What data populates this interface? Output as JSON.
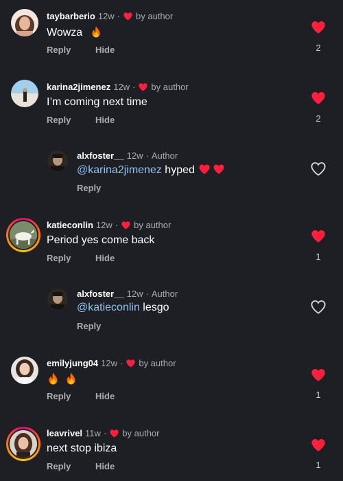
{
  "colors": {
    "background": "#1d1f24",
    "like_red": "#ff1f3d",
    "mention": "#8ec3f2",
    "muted": "#a9acb3"
  },
  "comments": [
    {
      "user": "taybarberio",
      "time": "12w",
      "badge": "by author",
      "text": "Wowza",
      "emoji": "fire",
      "reply": "Reply",
      "hide": "Hide",
      "likes": "2",
      "liked": true
    },
    {
      "user": "karina2jimenez",
      "time": "12w",
      "badge": "by author",
      "text": "I’m coming next time",
      "reply": "Reply",
      "hide": "Hide",
      "likes": "2",
      "liked": true
    },
    {
      "user": "alxfoster__",
      "time": "12w",
      "badge": "Author",
      "mention": "@karina2jimenez",
      "text": " hyped",
      "emoji": "hearts",
      "reply": "Reply",
      "liked": false
    },
    {
      "user": "katieconlin",
      "time": "12w",
      "badge": "by author",
      "text": "Period yes come back",
      "reply": "Reply",
      "hide": "Hide",
      "likes": "1",
      "liked": true
    },
    {
      "user": "alxfoster__",
      "time": "12w",
      "badge": "Author",
      "mention": "@katieconlin",
      "text": " lesgo",
      "reply": "Reply",
      "liked": false
    },
    {
      "user": "emilyjung04",
      "time": "12w",
      "badge": "by author",
      "emoji": "fire-fire",
      "reply": "Reply",
      "hide": "Hide",
      "likes": "1",
      "liked": true
    },
    {
      "user": "leavrivel",
      "time": "11w",
      "badge": "by author",
      "text": "next stop ibiza",
      "reply": "Reply",
      "hide": "Hide",
      "likes": "1",
      "liked": true
    }
  ],
  "separator_dot": "·"
}
